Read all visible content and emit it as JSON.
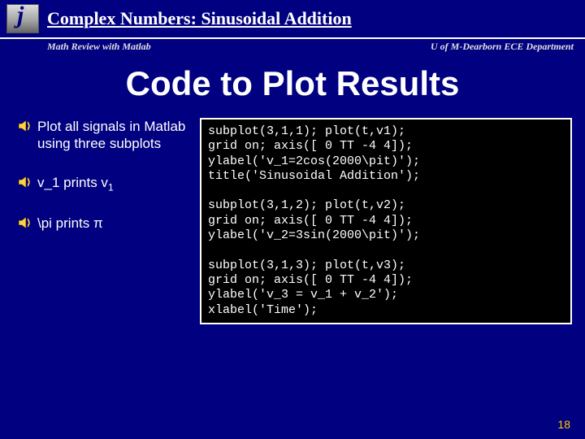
{
  "header": {
    "topic": "Complex Numbers",
    "subtopic": "Sinusoidal Addition",
    "left_sub": "Math Review with Matlab",
    "right_sub": "U of M-Dearborn ECE Department"
  },
  "title": "Code to Plot Results",
  "bullets": [
    {
      "html": "Plot all signals in Matlab using three subplots"
    },
    {
      "html": "v_1  prints v<span class='sub'>1</span>"
    },
    {
      "html": "\\pi prints π"
    }
  ],
  "code": "subplot(3,1,1); plot(t,v1);\ngrid on; axis([ 0 TT -4 4]);\nylabel('v_1=2cos(2000\\pit)');\ntitle('Sinusoidal Addition');\n\nsubplot(3,1,2); plot(t,v2);\ngrid on; axis([ 0 TT -4 4]);\nylabel('v_2=3sin(2000\\pit)');\n\nsubplot(3,1,3); plot(t,v3);\ngrid on; axis([ 0 TT -4 4]);\nylabel('v_3 = v_1 + v_2');\nxlabel('Time');",
  "page_number": "18"
}
